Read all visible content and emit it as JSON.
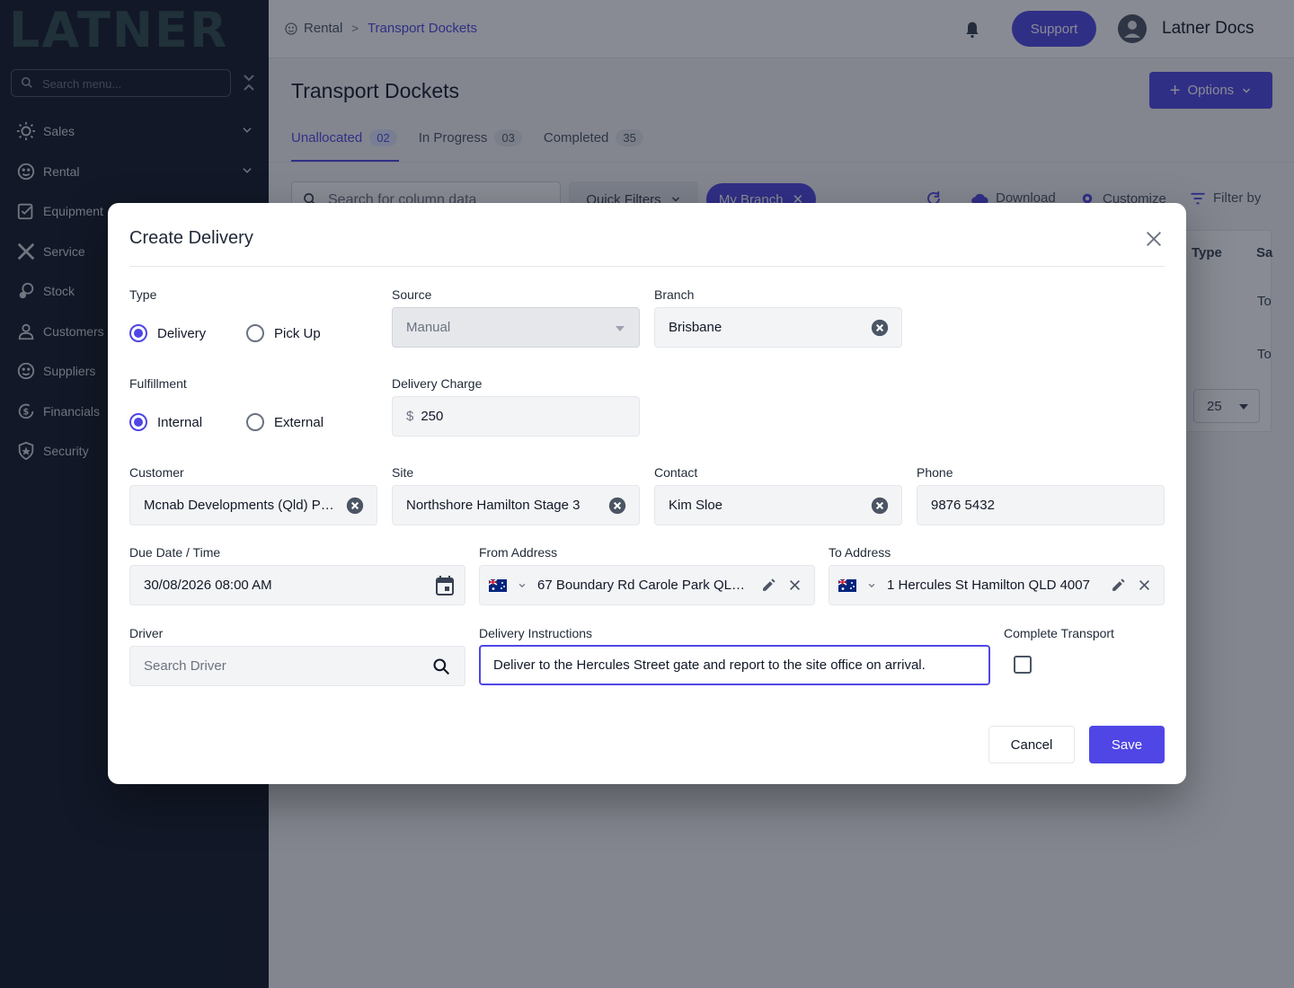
{
  "app": {
    "logo_text": "LATNER"
  },
  "sidebar": {
    "search_placeholder": "Search menu...",
    "items": [
      {
        "label": "Sales",
        "icon": "sales-icon",
        "expandable": true
      },
      {
        "label": "Rental",
        "icon": "rental-icon",
        "expandable": true
      },
      {
        "label": "Equipment",
        "icon": "equipment-icon",
        "expandable": false
      },
      {
        "label": "Service",
        "icon": "service-icon",
        "expandable": false
      },
      {
        "label": "Stock",
        "icon": "stock-icon",
        "expandable": false
      },
      {
        "label": "Customers",
        "icon": "customers-icon",
        "expandable": false
      },
      {
        "label": "Suppliers",
        "icon": "suppliers-icon",
        "expandable": false
      },
      {
        "label": "Financials",
        "icon": "financials-icon",
        "expandable": false
      },
      {
        "label": "Security",
        "icon": "security-icon",
        "expandable": false
      }
    ]
  },
  "header": {
    "breadcrumb": [
      "Rental",
      "Transport Dockets"
    ],
    "support_label": "Support",
    "user_name": "Latner Docs"
  },
  "page": {
    "title": "Transport Dockets",
    "options_label": "Options",
    "tabs": [
      {
        "label": "Unallocated",
        "count": "02",
        "active": true
      },
      {
        "label": "In Progress",
        "count": "03",
        "active": false
      },
      {
        "label": "Completed",
        "count": "35",
        "active": false
      }
    ],
    "toolbar": {
      "search_placeholder": "Search for column data",
      "quick_filters_label": "Quick Filters",
      "branch_chip_label": "My Branch",
      "download_label": "Download",
      "customize_label": "Customize",
      "filter_label": "Filter by"
    },
    "table": {
      "headers": [
        "Type",
        "Sa"
      ],
      "rows": [
        [
          "To"
        ],
        [
          "To"
        ]
      ],
      "per_page": "25"
    }
  },
  "modal": {
    "title": "Create Delivery",
    "type": {
      "label": "Type",
      "options": [
        "Delivery",
        "Pick Up"
      ],
      "selected": "Delivery"
    },
    "source": {
      "label": "Source",
      "value": "Manual"
    },
    "branch": {
      "label": "Branch",
      "value": "Brisbane"
    },
    "fulfillment": {
      "label": "Fulfillment",
      "options": [
        "Internal",
        "External"
      ],
      "selected": "Internal"
    },
    "delivery_charge": {
      "label": "Delivery Charge",
      "currency": "$",
      "value": "250"
    },
    "customer": {
      "label": "Customer",
      "value": "Mcnab Developments (Qld) Pty L"
    },
    "site": {
      "label": "Site",
      "value": "Northshore Hamilton Stage 3"
    },
    "contact": {
      "label": "Contact",
      "value": "Kim Sloe"
    },
    "phone": {
      "label": "Phone",
      "value": "9876 5432"
    },
    "due_date": {
      "label": "Due Date / Time",
      "value": "30/08/2026 08:00 AM"
    },
    "from_address": {
      "label": "From Address",
      "value": "67 Boundary Rd Carole Park QLD ..."
    },
    "to_address": {
      "label": "To Address",
      "value": "1 Hercules St Hamilton QLD 4007"
    },
    "driver": {
      "label": "Driver",
      "placeholder": "Search Driver"
    },
    "instructions": {
      "label": "Delivery Instructions",
      "value": "Deliver to the Hercules Street gate and report to the site office on arrival."
    },
    "complete_transport": {
      "label": "Complete Transport",
      "checked": false
    },
    "cancel_label": "Cancel",
    "save_label": "Save"
  },
  "colors": {
    "accent": "#4f46e5",
    "sidebar_bg": "#121826",
    "logo_color": "#2f4a4a"
  }
}
